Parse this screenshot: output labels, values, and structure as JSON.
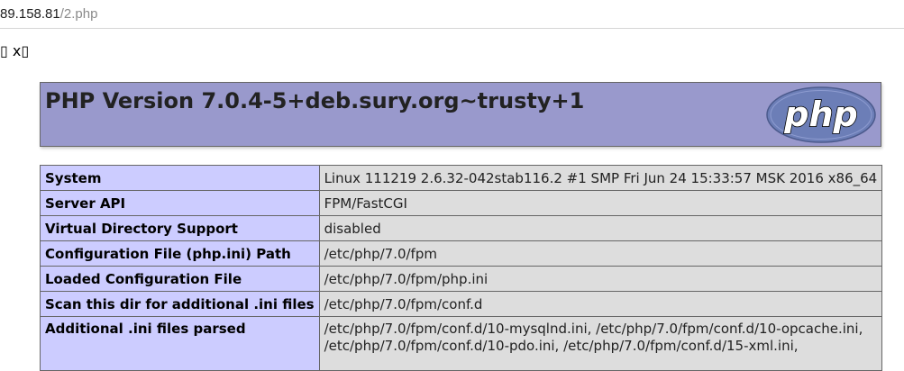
{
  "browser": {
    "url_host": "89.158.81",
    "url_path": "/2.php"
  },
  "page": {
    "stray_text": "▯ x▯"
  },
  "banner": {
    "title": "PHP Version 7.0.4-5+deb.sury.org~trusty+1",
    "logo_text": "php"
  },
  "info_rows": [
    {
      "key": "System",
      "value": "Linux 111219 2.6.32-042stab116.2 #1 SMP Fri Jun 24 15:33:57 MSK 2016 x86_64"
    },
    {
      "key": "Server API",
      "value": "FPM/FastCGI"
    },
    {
      "key": "Virtual Directory Support",
      "value": "disabled"
    },
    {
      "key": "Configuration File (php.ini) Path",
      "value": "/etc/php/7.0/fpm"
    },
    {
      "key": "Loaded Configuration File",
      "value": "/etc/php/7.0/fpm/php.ini"
    },
    {
      "key": "Scan this dir for additional .ini files",
      "value": "/etc/php/7.0/fpm/conf.d"
    },
    {
      "key": "Additional .ini files parsed",
      "lines": [
        "/etc/php/7.0/fpm/conf.d/10-mysqlnd.ini, /etc/php/7.0/fpm/conf.d/10-opcache.ini,",
        "/etc/php/7.0/fpm/conf.d/10-pdo.ini, /etc/php/7.0/fpm/conf.d/15-xml.ini,"
      ]
    }
  ],
  "colors": {
    "banner_bg": "#9999cc",
    "key_cell_bg": "#ccccff",
    "value_cell_bg": "#dddddd",
    "border": "#666666"
  }
}
